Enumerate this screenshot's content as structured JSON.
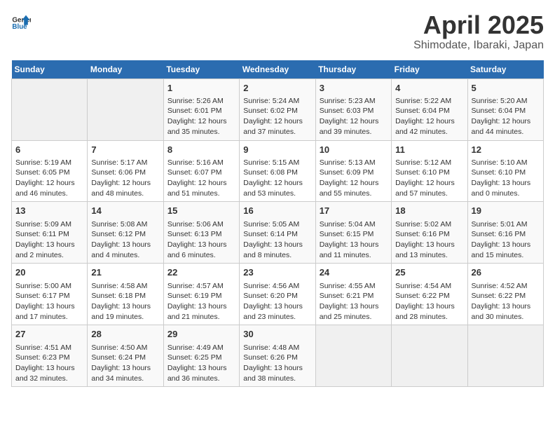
{
  "header": {
    "logo_general": "General",
    "logo_blue": "Blue",
    "main_title": "April 2025",
    "sub_title": "Shimodate, Ibaraki, Japan"
  },
  "days_of_week": [
    "Sunday",
    "Monday",
    "Tuesday",
    "Wednesday",
    "Thursday",
    "Friday",
    "Saturday"
  ],
  "weeks": [
    [
      {
        "day": "",
        "info": ""
      },
      {
        "day": "",
        "info": ""
      },
      {
        "day": "1",
        "info": "Sunrise: 5:26 AM\nSunset: 6:01 PM\nDaylight: 12 hours and 35 minutes."
      },
      {
        "day": "2",
        "info": "Sunrise: 5:24 AM\nSunset: 6:02 PM\nDaylight: 12 hours and 37 minutes."
      },
      {
        "day": "3",
        "info": "Sunrise: 5:23 AM\nSunset: 6:03 PM\nDaylight: 12 hours and 39 minutes."
      },
      {
        "day": "4",
        "info": "Sunrise: 5:22 AM\nSunset: 6:04 PM\nDaylight: 12 hours and 42 minutes."
      },
      {
        "day": "5",
        "info": "Sunrise: 5:20 AM\nSunset: 6:04 PM\nDaylight: 12 hours and 44 minutes."
      }
    ],
    [
      {
        "day": "6",
        "info": "Sunrise: 5:19 AM\nSunset: 6:05 PM\nDaylight: 12 hours and 46 minutes."
      },
      {
        "day": "7",
        "info": "Sunrise: 5:17 AM\nSunset: 6:06 PM\nDaylight: 12 hours and 48 minutes."
      },
      {
        "day": "8",
        "info": "Sunrise: 5:16 AM\nSunset: 6:07 PM\nDaylight: 12 hours and 51 minutes."
      },
      {
        "day": "9",
        "info": "Sunrise: 5:15 AM\nSunset: 6:08 PM\nDaylight: 12 hours and 53 minutes."
      },
      {
        "day": "10",
        "info": "Sunrise: 5:13 AM\nSunset: 6:09 PM\nDaylight: 12 hours and 55 minutes."
      },
      {
        "day": "11",
        "info": "Sunrise: 5:12 AM\nSunset: 6:10 PM\nDaylight: 12 hours and 57 minutes."
      },
      {
        "day": "12",
        "info": "Sunrise: 5:10 AM\nSunset: 6:10 PM\nDaylight: 13 hours and 0 minutes."
      }
    ],
    [
      {
        "day": "13",
        "info": "Sunrise: 5:09 AM\nSunset: 6:11 PM\nDaylight: 13 hours and 2 minutes."
      },
      {
        "day": "14",
        "info": "Sunrise: 5:08 AM\nSunset: 6:12 PM\nDaylight: 13 hours and 4 minutes."
      },
      {
        "day": "15",
        "info": "Sunrise: 5:06 AM\nSunset: 6:13 PM\nDaylight: 13 hours and 6 minutes."
      },
      {
        "day": "16",
        "info": "Sunrise: 5:05 AM\nSunset: 6:14 PM\nDaylight: 13 hours and 8 minutes."
      },
      {
        "day": "17",
        "info": "Sunrise: 5:04 AM\nSunset: 6:15 PM\nDaylight: 13 hours and 11 minutes."
      },
      {
        "day": "18",
        "info": "Sunrise: 5:02 AM\nSunset: 6:16 PM\nDaylight: 13 hours and 13 minutes."
      },
      {
        "day": "19",
        "info": "Sunrise: 5:01 AM\nSunset: 6:16 PM\nDaylight: 13 hours and 15 minutes."
      }
    ],
    [
      {
        "day": "20",
        "info": "Sunrise: 5:00 AM\nSunset: 6:17 PM\nDaylight: 13 hours and 17 minutes."
      },
      {
        "day": "21",
        "info": "Sunrise: 4:58 AM\nSunset: 6:18 PM\nDaylight: 13 hours and 19 minutes."
      },
      {
        "day": "22",
        "info": "Sunrise: 4:57 AM\nSunset: 6:19 PM\nDaylight: 13 hours and 21 minutes."
      },
      {
        "day": "23",
        "info": "Sunrise: 4:56 AM\nSunset: 6:20 PM\nDaylight: 13 hours and 23 minutes."
      },
      {
        "day": "24",
        "info": "Sunrise: 4:55 AM\nSunset: 6:21 PM\nDaylight: 13 hours and 25 minutes."
      },
      {
        "day": "25",
        "info": "Sunrise: 4:54 AM\nSunset: 6:22 PM\nDaylight: 13 hours and 28 minutes."
      },
      {
        "day": "26",
        "info": "Sunrise: 4:52 AM\nSunset: 6:22 PM\nDaylight: 13 hours and 30 minutes."
      }
    ],
    [
      {
        "day": "27",
        "info": "Sunrise: 4:51 AM\nSunset: 6:23 PM\nDaylight: 13 hours and 32 minutes."
      },
      {
        "day": "28",
        "info": "Sunrise: 4:50 AM\nSunset: 6:24 PM\nDaylight: 13 hours and 34 minutes."
      },
      {
        "day": "29",
        "info": "Sunrise: 4:49 AM\nSunset: 6:25 PM\nDaylight: 13 hours and 36 minutes."
      },
      {
        "day": "30",
        "info": "Sunrise: 4:48 AM\nSunset: 6:26 PM\nDaylight: 13 hours and 38 minutes."
      },
      {
        "day": "",
        "info": ""
      },
      {
        "day": "",
        "info": ""
      },
      {
        "day": "",
        "info": ""
      }
    ]
  ]
}
